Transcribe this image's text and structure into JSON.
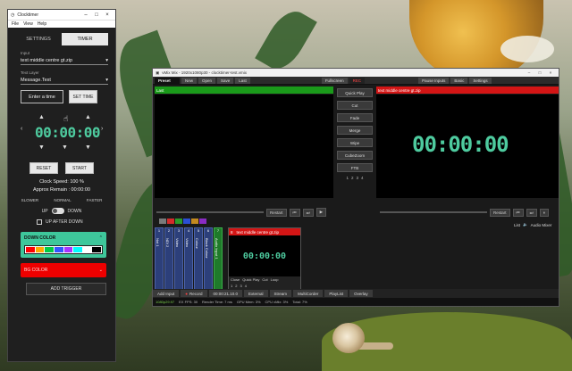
{
  "clocktimer": {
    "title": "Clocktimer",
    "menu": [
      "File",
      "View",
      "Help"
    ],
    "tabs": [
      "SETTINGS",
      "TIMER"
    ],
    "input_label": "Input",
    "input_value": "text middle centre gt.zip",
    "text_layer_label": "Text Layer",
    "text_layer_value": "Message.Text",
    "entry_placeholder": "Enter a time",
    "set_time": "SET TIME",
    "time": "00:00:00",
    "reset": "RESET",
    "start": "START",
    "clock_speed": "Clock Speed: 100 %",
    "approx_remain": "Approx Remain : 00:00:00",
    "speeds": [
      "SLOWER",
      "NORMAL",
      "FASTER"
    ],
    "toggle_up": "UP",
    "toggle_down": "DOWN",
    "up_after_down": "UP AFTER DOWN",
    "down_color": "DOWN COLOR",
    "bg_color": "BG COLOR",
    "add_trigger": "ADD TRIGGER",
    "palette": [
      "#ff0000",
      "#ffaa00",
      "#00cc44",
      "#3355ff",
      "#aa33ff",
      "#00ffff",
      "#ffffff",
      "#000000"
    ]
  },
  "vmix": {
    "title": "vMix Mix - 1920x1080p30 - clocktimer-test.vmix",
    "toolbar": [
      "Preset",
      "New",
      "Open",
      "Save",
      "Last"
    ],
    "fullscreen": "Fullscreen",
    "rec": "REC",
    "pause_inputs": "Pause Inputs",
    "basic": "Basic",
    "settings": "Settings",
    "preview_label": "Last",
    "output_label": "text middle centre gt.zip",
    "mid_buttons": [
      "Quick Play",
      "Cut",
      "Fade",
      "Merge",
      "Wipe",
      "CubeZoom",
      "FTB"
    ],
    "mid_nums": [
      "1",
      "2",
      "3",
      "4"
    ],
    "output_time": "00:00:00",
    "restart": "Restart",
    "list": "List",
    "audio_mixer": "Audio Mixer",
    "channels": [
      "Not 1",
      "NDI 2",
      "Video",
      "Video",
      "Colour",
      "Black Colour",
      "Audio Input 1"
    ],
    "channel_nums": [
      "1",
      "2",
      "3",
      "4",
      "5",
      "6",
      "7"
    ],
    "tile_num": "8",
    "tile_label": "text middle centre gt.zip",
    "tile_time": "00:00:00",
    "tile_buttons": [
      "Close",
      "Quick Play",
      "Cut",
      "Loop"
    ],
    "tile_nums": [
      "1",
      "2",
      "3",
      "4"
    ],
    "bottom": [
      "Add Input",
      "Record",
      "00:00:21.10.0",
      "External",
      "Stream",
      "MultiCorder",
      "PlayList",
      "Overlay"
    ],
    "status": [
      "1080p29.97",
      "EX  FPS: 30",
      "Render Time: 7 ms",
      "GPU Mem: 3%",
      "CPU vMix: 3%",
      "Total: 7%"
    ]
  }
}
